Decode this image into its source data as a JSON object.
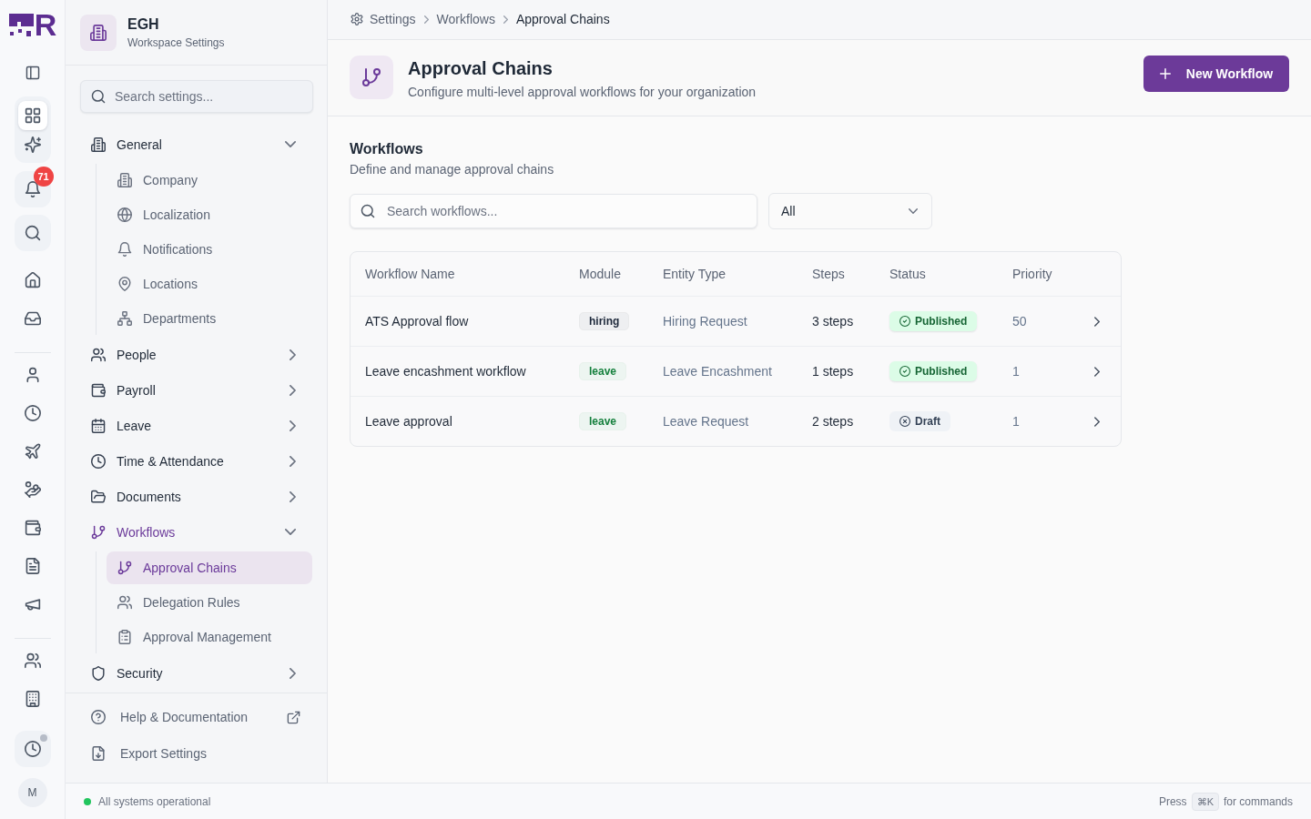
{
  "rail": {
    "logo_text": "R",
    "apps": [
      {
        "selected": true
      },
      {
        "selected": false
      }
    ],
    "notifications": {
      "badge": "71"
    },
    "module_groups": [
      [
        {
          "selected": false
        },
        {
          "selected": false
        }
      ],
      [
        {
          "selected": false
        },
        {
          "selected": false
        },
        {
          "selected": false
        },
        {
          "selected": false
        },
        {
          "selected": false
        },
        {
          "selected": false
        },
        {
          "selected": false
        }
      ],
      [
        {
          "selected": false
        },
        {
          "selected": false
        }
      ]
    ],
    "history": {
      "unread": true
    },
    "avatar": "M"
  },
  "sidebar": {
    "workspace": {
      "name": "EGH",
      "subtitle": "Workspace Settings"
    },
    "search": {
      "placeholder": "Search settings..."
    },
    "nav": [
      {
        "label": "General",
        "expanded": true,
        "children": [
          {
            "label": "Company",
            "selected": false
          },
          {
            "label": "Localization",
            "selected": false
          },
          {
            "label": "Notifications",
            "selected": false
          },
          {
            "label": "Locations",
            "selected": false
          },
          {
            "label": "Departments",
            "selected": false
          }
        ]
      },
      {
        "label": "People",
        "expanded": false
      },
      {
        "label": "Payroll",
        "expanded": false
      },
      {
        "label": "Leave",
        "expanded": false
      },
      {
        "label": "Time & Attendance",
        "expanded": false
      },
      {
        "label": "Documents",
        "expanded": false
      },
      {
        "label": "Workflows",
        "expanded": true,
        "children": [
          {
            "label": "Approval Chains",
            "selected": true
          },
          {
            "label": "Delegation Rules",
            "selected": false
          },
          {
            "label": "Approval Management",
            "selected": false
          }
        ]
      },
      {
        "label": "Security",
        "expanded": false
      }
    ],
    "links": [
      {
        "label": "Help & Documentation",
        "external": true
      },
      {
        "label": "Export Settings",
        "external": false
      }
    ]
  },
  "breadcrumb": [
    {
      "label": "Settings"
    },
    {
      "label": "Workflows"
    },
    {
      "label": "Approval Chains"
    }
  ],
  "page_header": {
    "title": "Approval Chains",
    "subtitle": "Configure multi-level approval workflows for your organization",
    "action": "New Workflow"
  },
  "workflows": {
    "title": "Workflows",
    "subtitle": "Define and manage approval chains",
    "search": {
      "placeholder": "Search workflows..."
    },
    "status_filter": {
      "value": "All"
    },
    "table": {
      "columns": [
        "Workflow Name",
        "Module",
        "Entity Type",
        "Steps",
        "Status",
        "Priority"
      ],
      "rows": [
        {
          "name": "ATS Approval flow",
          "module": {
            "label": "hiring",
            "color": "#1e293b"
          },
          "entity_type": "Hiring Request",
          "steps": "3 steps",
          "status": {
            "label": "Published",
            "kind": "published"
          },
          "priority": "50"
        },
        {
          "name": "Leave encashment workflow",
          "module": {
            "label": "leave",
            "color": "#15803d"
          },
          "entity_type": "Leave Encashment",
          "steps": "1 steps",
          "status": {
            "label": "Published",
            "kind": "published"
          },
          "priority": "1"
        },
        {
          "name": "Leave approval",
          "module": {
            "label": "leave",
            "color": "#15803d"
          },
          "entity_type": "Leave Request",
          "steps": "2 steps",
          "status": {
            "label": "Draft",
            "kind": "draft"
          },
          "priority": "1"
        }
      ]
    }
  },
  "status_bar": {
    "status": {
      "text": "All systems operational",
      "operational": true
    },
    "hint": {
      "prefix": "Press",
      "key": "⌘K",
      "suffix": "for commands"
    }
  }
}
